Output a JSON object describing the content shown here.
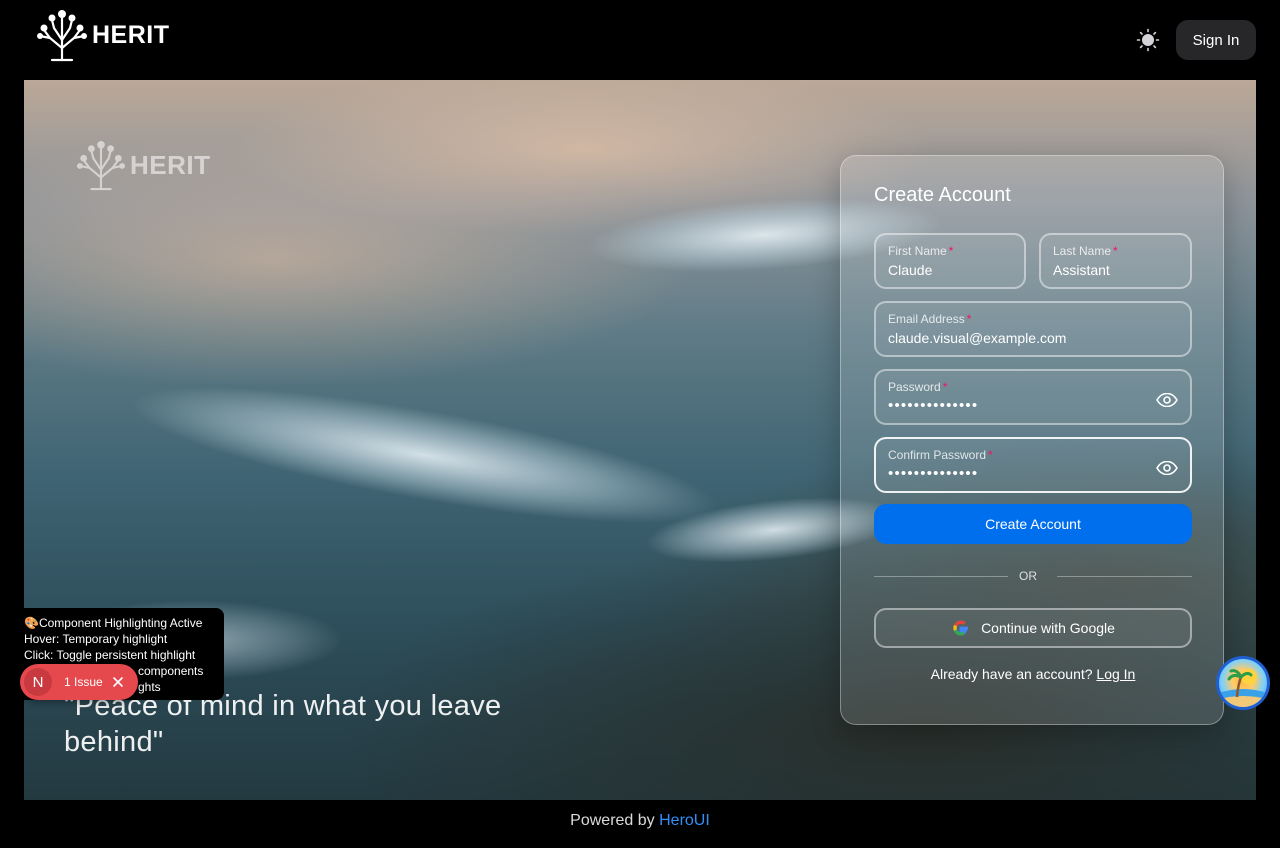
{
  "navbar": {
    "brand": "HERIT",
    "sign_in_label": "Sign In"
  },
  "hero": {
    "logo_text": "HERIT",
    "quote": "\"Peace of mind in what you leave behind\""
  },
  "form": {
    "title": "Create Account",
    "first_name": {
      "label": "First Name",
      "value": "Claude"
    },
    "last_name": {
      "label": "Last Name",
      "value": "Assistant"
    },
    "email": {
      "label": "Email Address",
      "value": "claude.visual@example.com"
    },
    "password": {
      "label": "Password",
      "value": "••••••••••••••"
    },
    "confirm_password": {
      "label": "Confirm Password",
      "value": "••••••••••••••"
    },
    "required_mark": "*",
    "submit_label": "Create Account",
    "divider_text": "OR",
    "google_label": "Continue with Google",
    "login_prompt": "Already have an account?",
    "login_link": "Log In"
  },
  "dev_overlay": {
    "tooltip_lines": [
      "🎨Component Highlighting Active",
      "Hover: Temporary highlight",
      "Click: Toggle persistent highlight",
      "components",
      "ghts"
    ],
    "issue_initial": "N",
    "issue_label": "1 Issue"
  },
  "footer": {
    "prefix": "Powered by",
    "link": "HeroUI"
  },
  "colors": {
    "primary": "#006fee",
    "danger": "#f31260",
    "issue_badge": "#e5484d",
    "link_blue": "#338ef7"
  },
  "icons": [
    "tree-logo-icon",
    "sun-icon",
    "eye-icon",
    "google-icon",
    "close-icon"
  ]
}
